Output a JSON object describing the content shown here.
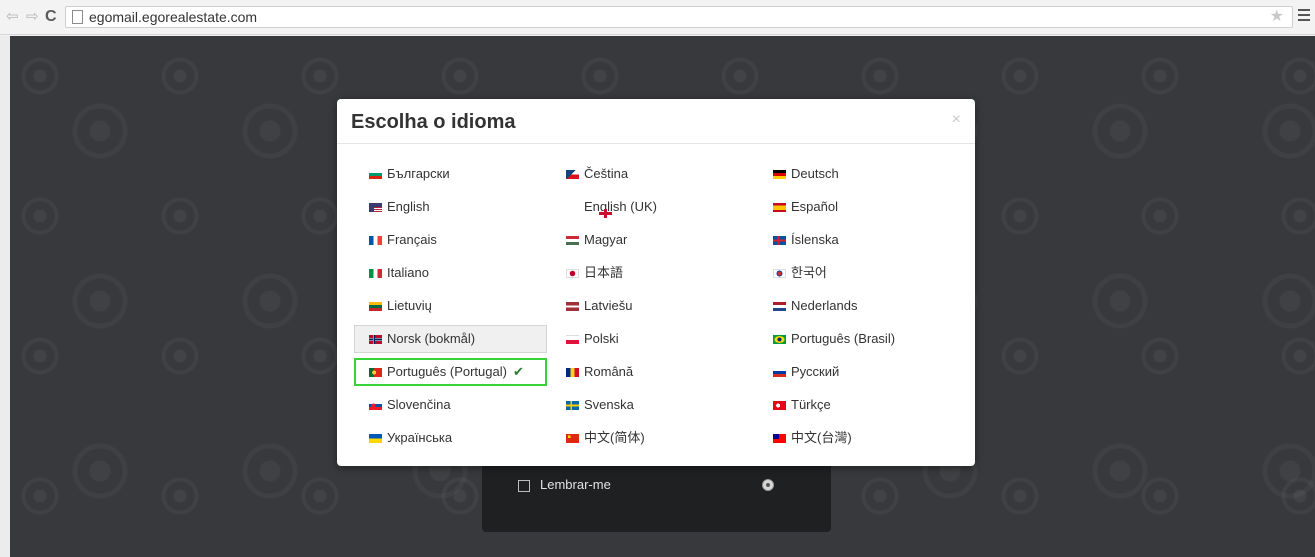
{
  "browser": {
    "url": "egomail.egorealestate.com",
    "back_glyph": "⇦",
    "forward_glyph": "⇨",
    "reload_glyph": "C",
    "star_glyph": "★"
  },
  "login": {
    "remember_label": "Lembrar-me"
  },
  "modal": {
    "title": "Escolha o idioma",
    "close_glyph": "×",
    "check_glyph": "✔",
    "languages": [
      {
        "label": "Български",
        "flag": "flag-bulgaria-icon"
      },
      {
        "label": "Čeština",
        "flag": "flag-czech-icon"
      },
      {
        "label": "Deutsch",
        "flag": "flag-germany-icon"
      },
      {
        "label": "English",
        "flag": "flag-usa-icon"
      },
      {
        "label": "English (UK)",
        "flag": "flag-uk-icon"
      },
      {
        "label": "Español",
        "flag": "flag-spain-icon"
      },
      {
        "label": "Français",
        "flag": "flag-france-icon"
      },
      {
        "label": "Magyar",
        "flag": "flag-hungary-icon"
      },
      {
        "label": "Íslenska",
        "flag": "flag-iceland-icon"
      },
      {
        "label": "Italiano",
        "flag": "flag-italy-icon"
      },
      {
        "label": "日本語",
        "flag": "flag-japan-icon"
      },
      {
        "label": "한국어",
        "flag": "flag-korea-icon"
      },
      {
        "label": "Lietuvių",
        "flag": "flag-lithuania-icon"
      },
      {
        "label": "Latviešu",
        "flag": "flag-latvia-icon"
      },
      {
        "label": "Nederlands",
        "flag": "flag-netherlands-icon"
      },
      {
        "label": "Norsk (bokmål)",
        "flag": "flag-norway-icon"
      },
      {
        "label": "Polski",
        "flag": "flag-poland-icon"
      },
      {
        "label": "Português (Brasil)",
        "flag": "flag-brazil-icon"
      },
      {
        "label": "Português (Portugal)",
        "flag": "flag-portugal-icon",
        "selected": true
      },
      {
        "label": "Română",
        "flag": "flag-romania-icon"
      },
      {
        "label": "Русский",
        "flag": "flag-russia-icon"
      },
      {
        "label": "Slovenčina",
        "flag": "flag-slovakia-icon"
      },
      {
        "label": "Svenska",
        "flag": "flag-sweden-icon"
      },
      {
        "label": "Türkçe",
        "flag": "flag-turkey-icon"
      },
      {
        "label": "Українська",
        "flag": "flag-ukraine-icon"
      },
      {
        "label": "中文(简体)",
        "flag": "flag-china-icon"
      },
      {
        "label": "中文(台灣)",
        "flag": "flag-taiwan-icon"
      }
    ]
  },
  "colors": {
    "selected_border": "#38d338",
    "page_background": "#37393c",
    "check": "#2a7a2a"
  }
}
